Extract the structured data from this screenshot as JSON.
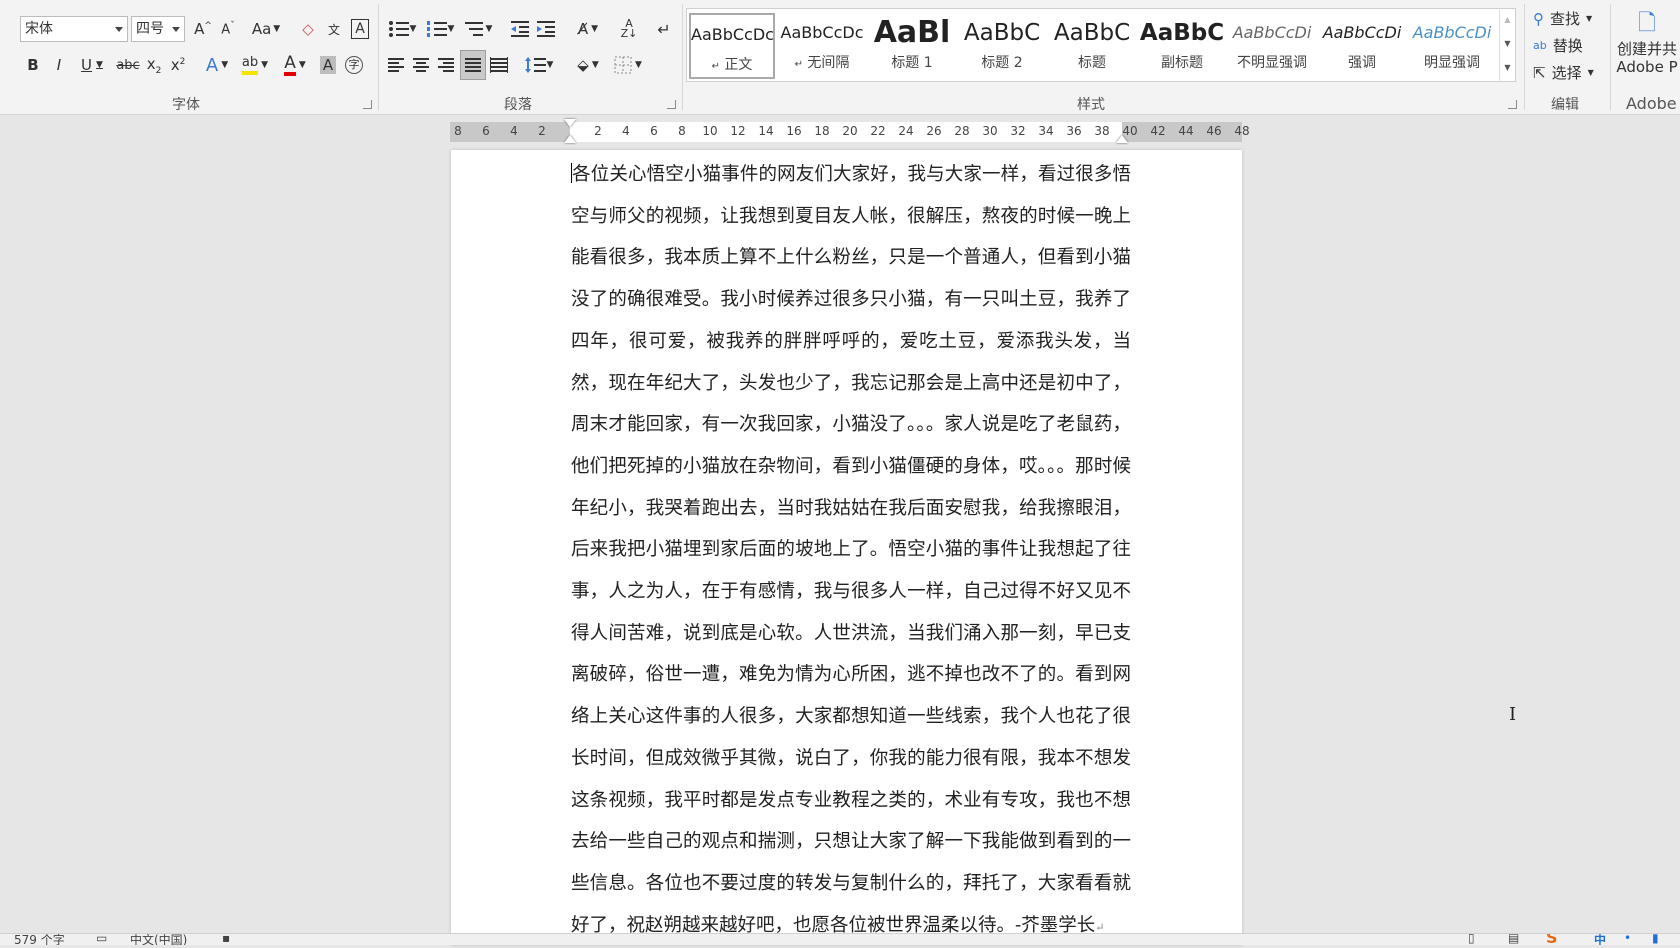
{
  "font_group": {
    "label": "字体",
    "font_name": "宋体",
    "font_size": "四号",
    "change_case": "Aa",
    "bold": "B",
    "italic": "I",
    "underline": "U",
    "strikethrough": "abc"
  },
  "paragraph_group": {
    "label": "段落"
  },
  "styles_group": {
    "label": "样式",
    "items": [
      {
        "sample": "AaBbCcDc",
        "name": "正文"
      },
      {
        "sample": "AaBbCcDc",
        "name": "无间隔"
      },
      {
        "sample": "AaBl",
        "name": "标题 1"
      },
      {
        "sample": "AaBbC",
        "name": "标题 2"
      },
      {
        "sample": "AaBbC",
        "name": "标题"
      },
      {
        "sample": "AaBbC",
        "name": "副标题"
      },
      {
        "sample": "AaBbCcDi",
        "name": "不明显强调"
      },
      {
        "sample": "AaBbCcDi",
        "name": "强调"
      },
      {
        "sample": "AaBbCcDi",
        "name": "明显强调"
      }
    ]
  },
  "editing_group": {
    "label": "编辑",
    "find": "查找",
    "replace": "替换",
    "select": "选择"
  },
  "adobe_group": {
    "label": "Adobe",
    "create_line1": "创建并共",
    "create_line2": "Adobe P"
  },
  "ruler": {
    "numbers": [
      "8",
      "6",
      "4",
      "2",
      "2",
      "4",
      "6",
      "8",
      "10",
      "12",
      "14",
      "16",
      "18",
      "20",
      "22",
      "24",
      "26",
      "28",
      "30",
      "32",
      "34",
      "36",
      "38",
      "40",
      "42",
      "44",
      "46",
      "48"
    ]
  },
  "document": {
    "body": "各位关心悟空小猫事件的网友们大家好，我与大家一样，看过很多悟空与师父的视频，让我想到夏目友人帐，很解压，熬夜的时候一晚上能看很多，我本质上算不上什么粉丝，只是一个普通人，但看到小猫没了的确很难受。我小时候养过很多只小猫，有一只叫土豆，我养了四年，很可爱，被我养的胖胖呼呼的，爱吃土豆，爱添我头发，当然，现在年纪大了，头发也少了，我忘记那会是上高中还是初中了，周末才能回家，有一次我回家，小猫没了。。。家人说是吃了老鼠药，他们把死掉的小猫放在杂物间，看到小猫僵硬的身体，哎。。。那时候年纪小，我哭着跑出去，当时我姑姑在我后面安慰我，给我擦眼泪，后来我把小猫埋到家后面的坡地上了。悟空小猫的事件让我想起了往事，人之为人，在于有感情，我与很多人一样，自己过得不好又见不得人间苦难，说到底是心软。人世洪流，当我们涌入那一刻，早已支离破碎，俗世一遭，难免为情为心所困，逃不掉也改不了的。看到网络上关心这件事的人很多，大家都想知道一些线索，我个人也花了很长时间，但成效微乎其微，说白了，你我的能力很有限，我本不想发这条视频，我平时都是发点专业教程之类的，术业有专攻，我也不想去给一些自己的观点和揣测，只想让大家了解一下我能做到看到的一些信息。各位也不要过度的转发与复制什么的，拜托了，大家看看就好了，祝赵朔越来越好吧，也愿各位被世界温柔以待。-芥墨学长"
  },
  "statusbar": {
    "word_count": "579 个字",
    "language": "中文(中国)",
    "ime_label": "中"
  },
  "colors": {
    "highlight": "#f5e400",
    "font_color": "#e00000",
    "styles_link": "#4a90c8"
  }
}
